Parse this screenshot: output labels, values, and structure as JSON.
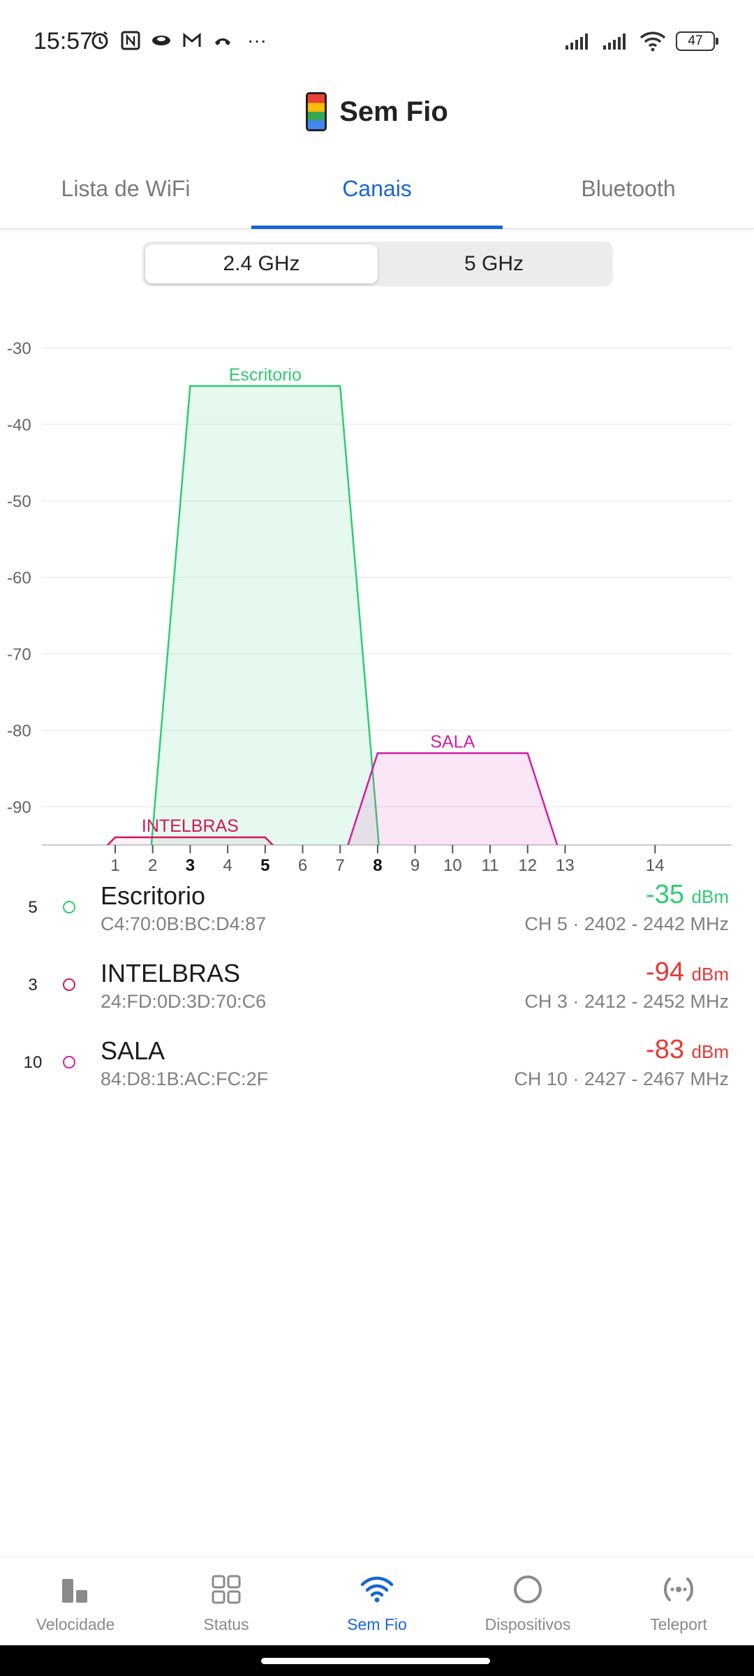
{
  "status_bar": {
    "time": "15:57",
    "left_icons": [
      "alarm-icon",
      "nfc-icon",
      "eye-icon",
      "gmail-icon",
      "call-icon",
      "more-icon"
    ],
    "more_text": "···",
    "battery": "47"
  },
  "header": {
    "title": "Sem Fio"
  },
  "tabs": [
    {
      "label": "Lista de WiFi",
      "active": false
    },
    {
      "label": "Canais",
      "active": true
    },
    {
      "label": "Bluetooth",
      "active": false
    }
  ],
  "band_selector": {
    "options": [
      {
        "label": "2.4 GHz",
        "active": true
      },
      {
        "label": "5 GHz",
        "active": false
      }
    ]
  },
  "chart_data": {
    "type": "area",
    "y_ticks": [
      "-30",
      "-40",
      "-50",
      "-60",
      "-70",
      "-80",
      "-90"
    ],
    "ylim": [
      -95,
      -30
    ],
    "x_ticks": [
      {
        "label": "1",
        "channel": 1,
        "bold": false
      },
      {
        "label": "2",
        "channel": 2,
        "bold": false
      },
      {
        "label": "3",
        "channel": 3,
        "bold": true
      },
      {
        "label": "4",
        "channel": 4,
        "bold": false
      },
      {
        "label": "5",
        "channel": 5,
        "bold": true
      },
      {
        "label": "6",
        "channel": 6,
        "bold": false
      },
      {
        "label": "7",
        "channel": 7,
        "bold": false
      },
      {
        "label": "8",
        "channel": 8,
        "bold": true
      },
      {
        "label": "9",
        "channel": 9,
        "bold": false
      },
      {
        "label": "10",
        "channel": 10,
        "bold": false
      },
      {
        "label": "11",
        "channel": 11,
        "bold": false
      },
      {
        "label": "12",
        "channel": 12,
        "bold": false
      },
      {
        "label": "13",
        "channel": 13,
        "bold": false
      },
      {
        "label": "14",
        "channel": 15.4,
        "bold": false
      }
    ],
    "series": [
      {
        "name": "Escritorio",
        "color": "#2ecc71",
        "fill": "rgba(46,204,113,0.12)",
        "signal": -35,
        "start_channel": 3,
        "end_channel": 7,
        "slope": 0.7
      },
      {
        "name": "INTELBRAS",
        "color": "#d4145a",
        "fill": "rgba(212,20,90,0.06)",
        "signal": -94,
        "start_channel": 1,
        "end_channel": 5,
        "slope": 0.75
      },
      {
        "name": "SALA",
        "color": "#d01ea6",
        "fill": "rgba(224,80,200,0.14)",
        "signal": -83,
        "start_channel": 8,
        "end_channel": 12,
        "slope": 0.7
      }
    ]
  },
  "networks": [
    {
      "channel": "5",
      "name": "Escritorio",
      "mac": "C4:70:0B:BC:D4:87",
      "signal": "-35",
      "unit": "dBm",
      "info": "CH 5 · 2402 - 2442 MHz",
      "dot_color": "#2ecc71",
      "signal_color": "#2ecc71"
    },
    {
      "channel": "3",
      "name": "INTELBRAS",
      "mac": "24:FD:0D:3D:70:C6",
      "signal": "-94",
      "unit": "dBm",
      "info": "CH 3 · 2412 - 2452 MHz",
      "dot_color": "#d4145a",
      "signal_color": "#e53935"
    },
    {
      "channel": "10",
      "name": "SALA",
      "mac": "84:D8:1B:AC:FC:2F",
      "signal": "-83",
      "unit": "dBm",
      "info": "CH 10 · 2427 - 2467 MHz",
      "dot_color": "#d01ea6",
      "signal_color": "#e53935"
    }
  ],
  "bottom_nav": [
    {
      "label": "Velocidade",
      "icon": "speed-bars-icon",
      "active": false
    },
    {
      "label": "Status",
      "icon": "grid-icon",
      "active": false
    },
    {
      "label": "Sem Fio",
      "icon": "wifi-icon",
      "active": true
    },
    {
      "label": "Dispositivos",
      "icon": "circle-icon",
      "active": false
    },
    {
      "label": "Teleport",
      "icon": "teleport-icon",
      "active": false
    }
  ]
}
